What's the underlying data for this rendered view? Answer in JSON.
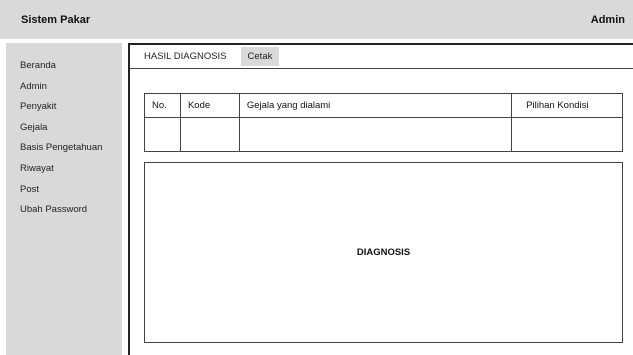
{
  "header": {
    "app_title": "Sistem Pakar",
    "user_label": "Admin"
  },
  "sidebar": {
    "items": [
      {
        "label": "Beranda"
      },
      {
        "label": "Admin"
      },
      {
        "label": "Penyakit"
      },
      {
        "label": "Gejala"
      },
      {
        "label": "Basis Pengetahuan"
      },
      {
        "label": "Riwayat"
      },
      {
        "label": "Post"
      },
      {
        "label": "Ubah Password"
      }
    ]
  },
  "main": {
    "tab_title": "HASIL DIAGNOSIS",
    "print_button": "Cetak",
    "table": {
      "headers": [
        "No.",
        "Kode",
        "Gejala yang dialami",
        "Pilihan Kondisi"
      ]
    },
    "diagnosis_label": "DIAGNOSIS"
  },
  "colors": {
    "panel_gray": "#d9d9d9",
    "border_dark": "#222222"
  }
}
